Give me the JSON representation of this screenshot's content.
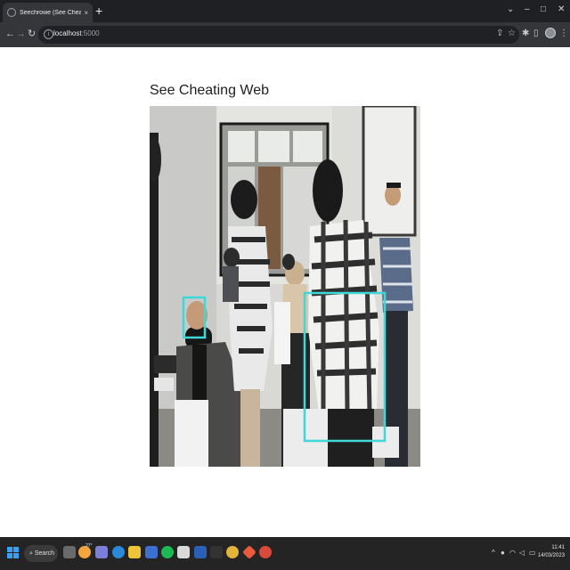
{
  "browser": {
    "tab_title": "Seechrowe (See Cheating Web)",
    "tab_close": "×",
    "new_tab": "+",
    "window_controls": {
      "chevron": "⌄",
      "minimize": "–",
      "maximize": "□",
      "close": "✕"
    },
    "nav": {
      "back": "←",
      "forward": "→",
      "reload": "↻"
    },
    "url_host": "localhost",
    "url_port": ":5000",
    "icons": [
      "share-icon",
      "star-icon",
      "extensions-icon",
      "sidebar-icon",
      "profile-avatar",
      "menu-icon"
    ]
  },
  "page": {
    "title": "See Cheating Web",
    "video_alt": "Classroom camera feed with detection boxes",
    "detection_color": "#3fd8d8"
  },
  "taskbar": {
    "search_label": "Search",
    "weather_temp": "27°",
    "time": "11:41",
    "date": "14/03/2023",
    "tray_chevron": "^",
    "apps": [
      "task-view",
      "weather",
      "copilot",
      "edge",
      "file-explorer",
      "store",
      "spotify",
      "app-generic",
      "word",
      "app-dark",
      "chrome",
      "app-diamond",
      "chrome-alt"
    ]
  }
}
